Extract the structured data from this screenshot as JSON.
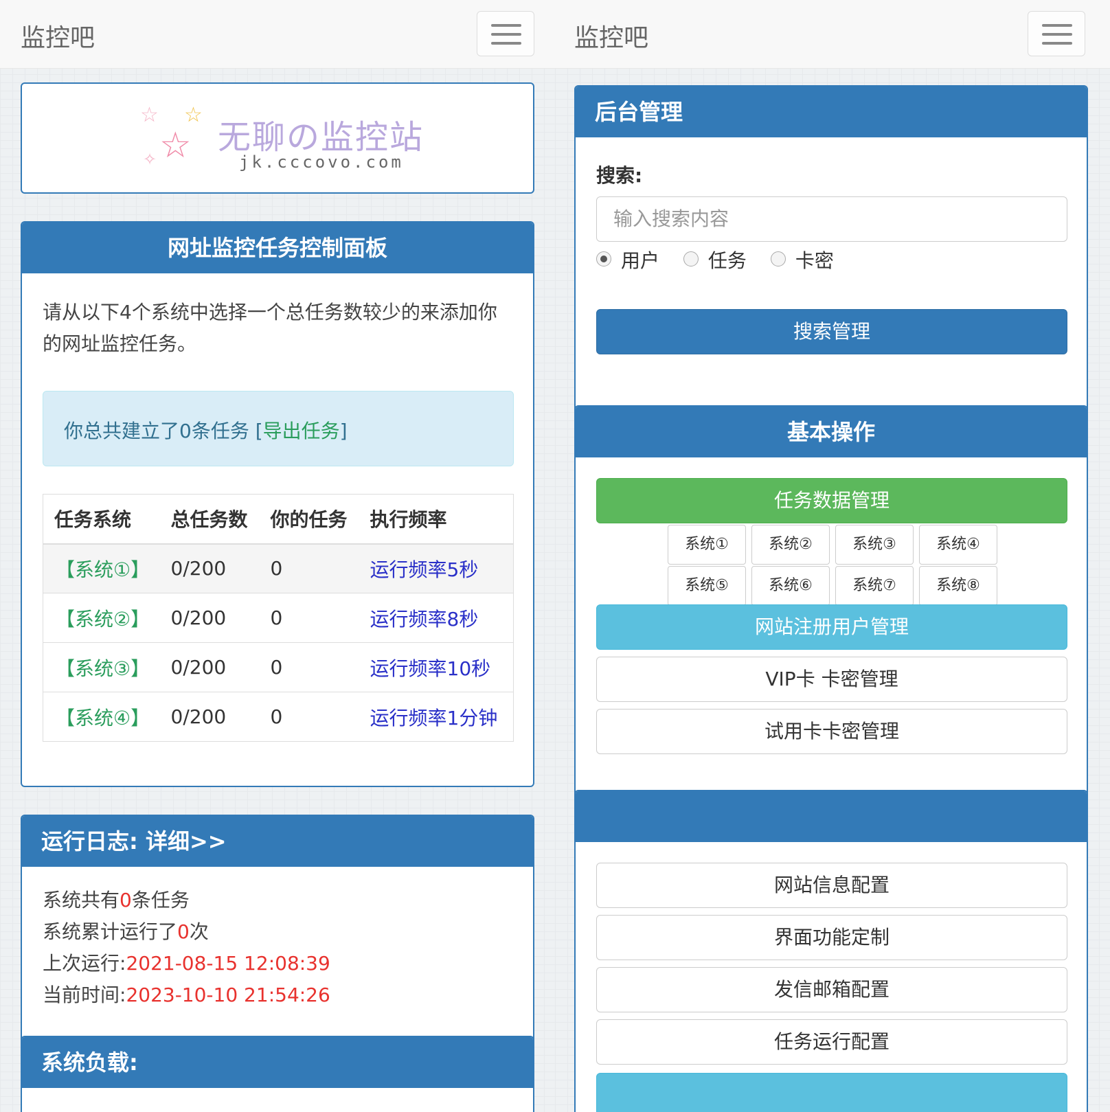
{
  "brand": "监控吧",
  "left": {
    "logo": {
      "title": "无聊の监控站",
      "subtitle": "jk.cccovo.com"
    },
    "control_panel": {
      "title": "网址监控任务控制面板",
      "intro": "请从以下4个系统中选择一个总任务数较少的来添加你的网址监控任务。",
      "alert_text": "你总共建立了0条任务 [",
      "alert_link": "导出任务",
      "alert_end": "]",
      "columns": [
        "任务系统",
        "总任务数",
        "你的任务",
        "执行频率"
      ],
      "rows": [
        {
          "system": "【系统①】",
          "total": "0/200",
          "mine": "0",
          "freq": "运行频率5秒"
        },
        {
          "system": "【系统②】",
          "total": "0/200",
          "mine": "0",
          "freq": "运行频率8秒"
        },
        {
          "system": "【系统③】",
          "total": "0/200",
          "mine": "0",
          "freq": "运行频率10秒"
        },
        {
          "system": "【系统④】",
          "total": "0/200",
          "mine": "0",
          "freq": "运行频率1分钟"
        }
      ]
    },
    "log_panel": {
      "title": "运行日志:  详细>>",
      "line1_label": "系统共有",
      "line1_value": "0",
      "line1_unit": "条任务",
      "line2_label": "系统累计运行了",
      "line2_value": "0",
      "line2_unit": "次",
      "line3_label": "上次运行:",
      "line3_value": "2021-08-15 12:08:39",
      "line4_label": "当前时间:",
      "line4_value": "2023-10-10 21:54:26"
    },
    "load_panel": {
      "title": "系统负载:"
    }
  },
  "right": {
    "admin_panel": {
      "title": "后台管理",
      "search_label": "搜索:",
      "search_placeholder": "输入搜索内容",
      "radios": [
        {
          "label": "用户",
          "checked": true
        },
        {
          "label": "任务",
          "checked": false
        },
        {
          "label": "卡密",
          "checked": false
        }
      ],
      "search_button": "搜索管理"
    },
    "basic_panel": {
      "title": "基本操作",
      "task_data_button": "任务数据管理",
      "systems": [
        "系统①",
        "系统②",
        "系统③",
        "系统④",
        "系统⑤",
        "系统⑥",
        "系统⑦",
        "系统⑧"
      ],
      "user_button": "网站注册用户管理",
      "vip_button": "VIP卡 卡密管理",
      "trial_button": "试用卡卡密管理"
    },
    "config_panel": {
      "buttons": [
        "网站信息配置",
        "界面功能定制",
        "发信邮箱配置",
        "任务运行配置"
      ]
    }
  },
  "colors": {
    "primary": "#337ab7",
    "success": "#5cb85c",
    "info": "#5bc0de",
    "accent_red": "#e8322e",
    "link_green": "#2a9d5c",
    "link_blue": "#2a30c8"
  }
}
